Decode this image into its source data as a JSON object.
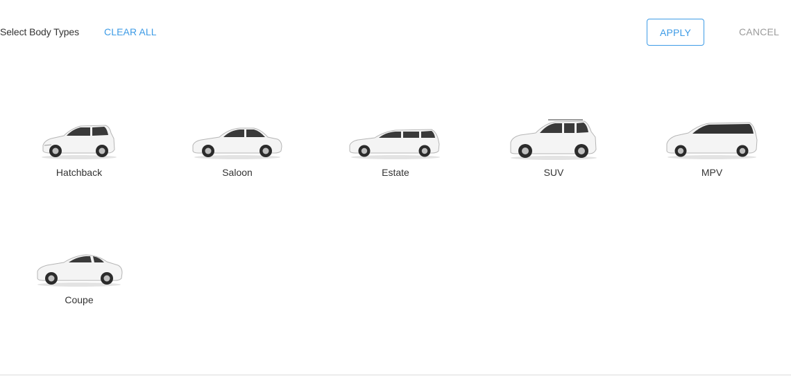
{
  "header": {
    "title": "Select Body Types",
    "clear_all_label": "CLEAR ALL",
    "apply_label": "APPLY",
    "cancel_label": "CANCEL"
  },
  "colors": {
    "accent": "#3d9be6",
    "muted": "#9b9b9b",
    "text": "#333333"
  },
  "body_types": [
    {
      "label": "Hatchback",
      "icon": "hatchback-car-icon"
    },
    {
      "label": "Saloon",
      "icon": "saloon-car-icon"
    },
    {
      "label": "Estate",
      "icon": "estate-car-icon"
    },
    {
      "label": "SUV",
      "icon": "suv-car-icon"
    },
    {
      "label": "MPV",
      "icon": "mpv-car-icon"
    },
    {
      "label": "Coupe",
      "icon": "coupe-car-icon"
    }
  ]
}
